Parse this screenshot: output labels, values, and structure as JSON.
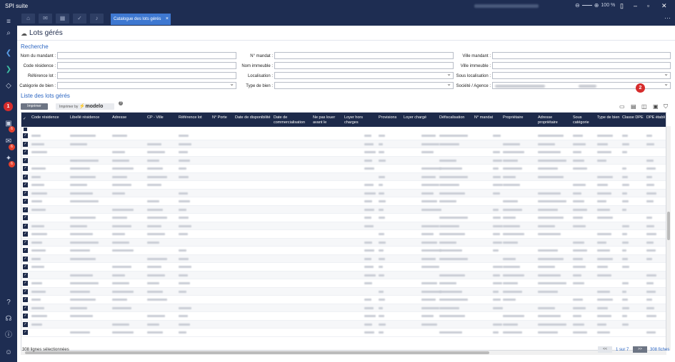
{
  "app": {
    "title": "SPI suite",
    "zoom": "100 %"
  },
  "tabs": {
    "active_label": "Catalogue des lots gérés"
  },
  "page": {
    "title": "Lots gérés"
  },
  "search": {
    "section_title": "Recherche",
    "col1": [
      "Nom du mandant :",
      "Code résidence :",
      "Référence lot :",
      "Catégorie de bien :"
    ],
    "col2": [
      "N° mandat :",
      "Nom immeuble :",
      "Localisation :",
      "Type de bien :"
    ],
    "col3": [
      "Ville mandant :",
      "Ville immeuble :",
      "Sous localisation :",
      "Société / Agence :"
    ]
  },
  "list": {
    "section_title": "Liste des lots gérés",
    "print_label": "Imprimer",
    "print_by_label": "Imprimer by",
    "modelo_label": "modelo",
    "columns": [
      "Code résidence",
      "Libellé résidence",
      "Adresse",
      "CP - Ville",
      "Référence lot",
      "N° Porte",
      "Date de disponibilité",
      "Date de commercialisation",
      "Ne pas louer avant le",
      "Loyer hors charges",
      "Provisions",
      "Loyer chargé",
      "Défiscalisation",
      "N° mandat",
      "Propriétaire",
      "Adresse propriétaire",
      "Sous catégorie",
      "Type de bien",
      "Classe DPE",
      "DPE établi"
    ]
  },
  "footer": {
    "selected": "308 lignes sélectionnées",
    "page": "1 sur 7",
    "count": "308 fiches",
    "prev": "<<",
    "next": ">>"
  },
  "badges": {
    "b1": "6",
    "b2": "6",
    "b3": "6"
  },
  "markers": {
    "m1": "1",
    "m2": "2"
  },
  "colors": {
    "nav": "#1e2d52",
    "accent": "#3e78d1",
    "header": "#1d2a4a",
    "marker": "#d62c2c"
  }
}
